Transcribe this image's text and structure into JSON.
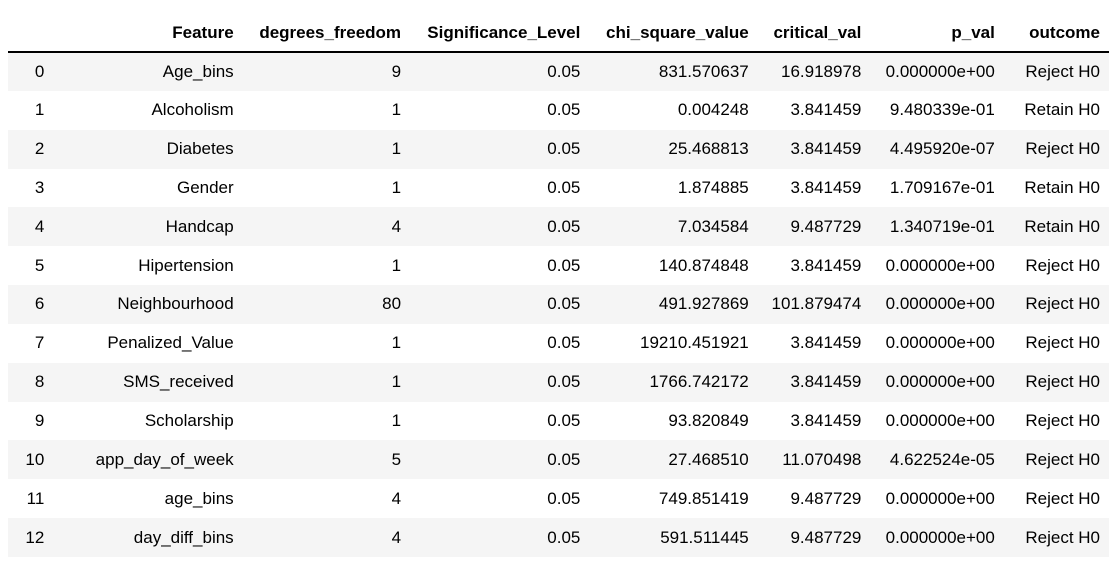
{
  "table": {
    "columns": [
      "",
      "Feature",
      "degrees_freedom",
      "Significance_Level",
      "chi_square_value",
      "critical_val",
      "p_val",
      "outcome"
    ],
    "rows": [
      [
        "0",
        "Age_bins",
        "9",
        "0.05",
        "831.570637",
        "16.918978",
        "0.000000e+00",
        "Reject H0"
      ],
      [
        "1",
        "Alcoholism",
        "1",
        "0.05",
        "0.004248",
        "3.841459",
        "9.480339e-01",
        "Retain H0"
      ],
      [
        "2",
        "Diabetes",
        "1",
        "0.05",
        "25.468813",
        "3.841459",
        "4.495920e-07",
        "Reject H0"
      ],
      [
        "3",
        "Gender",
        "1",
        "0.05",
        "1.874885",
        "3.841459",
        "1.709167e-01",
        "Retain H0"
      ],
      [
        "4",
        "Handcap",
        "4",
        "0.05",
        "7.034584",
        "9.487729",
        "1.340719e-01",
        "Retain H0"
      ],
      [
        "5",
        "Hipertension",
        "1",
        "0.05",
        "140.874848",
        "3.841459",
        "0.000000e+00",
        "Reject H0"
      ],
      [
        "6",
        "Neighbourhood",
        "80",
        "0.05",
        "491.927869",
        "101.879474",
        "0.000000e+00",
        "Reject H0"
      ],
      [
        "7",
        "Penalized_Value",
        "1",
        "0.05",
        "19210.451921",
        "3.841459",
        "0.000000e+00",
        "Reject H0"
      ],
      [
        "8",
        "SMS_received",
        "1",
        "0.05",
        "1766.742172",
        "3.841459",
        "0.000000e+00",
        "Reject H0"
      ],
      [
        "9",
        "Scholarship",
        "1",
        "0.05",
        "93.820849",
        "3.841459",
        "0.000000e+00",
        "Reject H0"
      ],
      [
        "10",
        "app_day_of_week",
        "5",
        "0.05",
        "27.468510",
        "11.070498",
        "4.622524e-05",
        "Reject H0"
      ],
      [
        "11",
        "age_bins",
        "4",
        "0.05",
        "749.851419",
        "9.487729",
        "0.000000e+00",
        "Reject H0"
      ],
      [
        "12",
        "day_diff_bins",
        "4",
        "0.05",
        "591.511445",
        "9.487729",
        "0.000000e+00",
        "Reject H0"
      ]
    ]
  }
}
